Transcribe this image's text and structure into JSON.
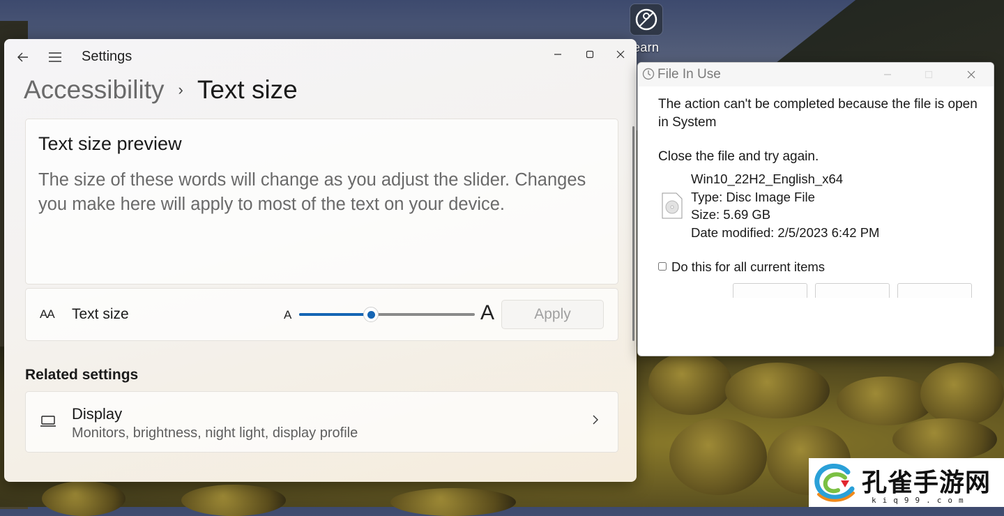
{
  "desktop": {
    "icon_label": "earn"
  },
  "settings": {
    "app_title": "Settings",
    "breadcrumb": {
      "parent": "Accessibility",
      "separator": "›",
      "current": "Text size"
    },
    "preview": {
      "title": "Text size preview",
      "text": "The size of these words will change as you adjust the slider. Changes you make here will apply to most of the text on your device."
    },
    "text_size": {
      "icon_glyph": "AA",
      "label": "Text size",
      "small_marker": "A",
      "large_marker": "A",
      "slider_value": 0.41,
      "apply_label": "Apply"
    },
    "related": {
      "heading": "Related settings",
      "display_title": "Display",
      "display_sub": "Monitors, brightness, night light, display profile"
    },
    "accent_color": "#1565b4"
  },
  "dialog": {
    "title": "File In Use",
    "message": "The action can't be completed because the file is open in System",
    "retry": "Close the file and try again.",
    "file": {
      "name": "Win10_22H2_English_x64",
      "type": "Type: Disc Image File",
      "size": "Size: 5.69 GB",
      "date": "Date modified: 2/5/2023 6:42 PM"
    },
    "checkbox_label": "Do this for all current items",
    "checkbox_checked": false
  },
  "watermark": {
    "text": "孔雀手游网",
    "sub": "kiq99.com"
  }
}
